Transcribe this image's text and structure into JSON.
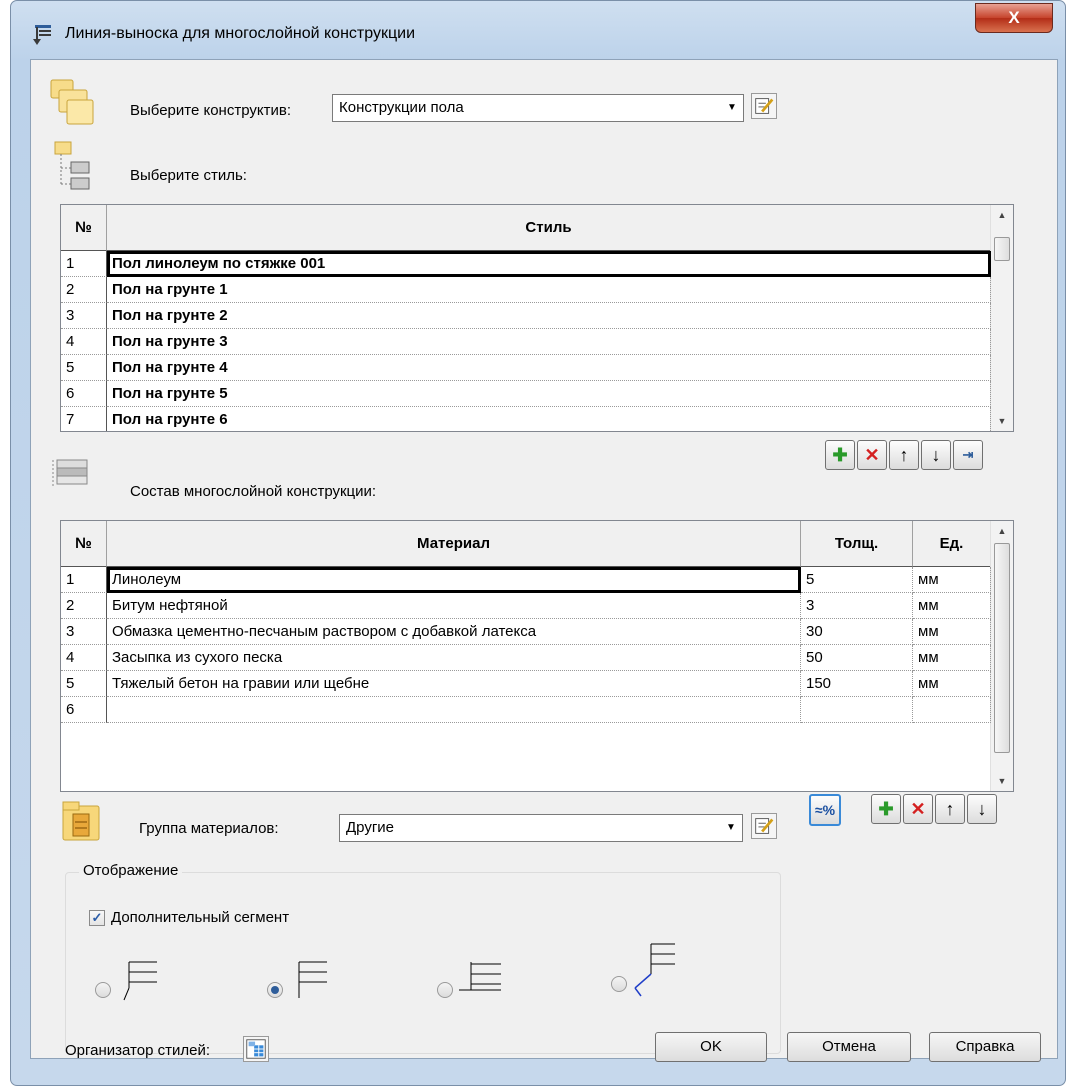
{
  "window": {
    "title": "Линия-выноска для многослойной конструкции",
    "close_label": "X"
  },
  "construct": {
    "label": "Выберите конструктив:",
    "value": "Конструкции пола"
  },
  "style_section": {
    "label": "Выберите стиль:"
  },
  "styles_table": {
    "col_num": "№",
    "col_style": "Стиль",
    "rows": [
      {
        "n": "1",
        "style": "Пол линолеум по стяжке 001"
      },
      {
        "n": "2",
        "style": "Пол на грунте 1"
      },
      {
        "n": "3",
        "style": "Пол на грунте 2"
      },
      {
        "n": "4",
        "style": "Пол на грунте 3"
      },
      {
        "n": "5",
        "style": "Пол на грунте 4"
      },
      {
        "n": "6",
        "style": "Пол на грунте 5"
      },
      {
        "n": "7",
        "style": "Пол на грунте 6"
      }
    ]
  },
  "layers_section": {
    "label": "Состав многослойной конструкции:"
  },
  "layers_table": {
    "col_num": "№",
    "col_material": "Материал",
    "col_thickness": "Толщ.",
    "col_unit": "Ед.",
    "rows": [
      {
        "n": "1",
        "material": "Линолеум",
        "thickness": "5",
        "unit": "мм"
      },
      {
        "n": "2",
        "material": "Битум нефтяной",
        "thickness": "3",
        "unit": "мм"
      },
      {
        "n": "3",
        "material": "Обмазка цементно-песчаным раствором с добавкой латекса",
        "thickness": "30",
        "unit": "мм"
      },
      {
        "n": "4",
        "material": "Засыпка из сухого песка",
        "thickness": "50",
        "unit": "мм"
      },
      {
        "n": "5",
        "material": "Тяжелый бетон на гравии или щебне",
        "thickness": "150",
        "unit": "мм"
      },
      {
        "n": "6",
        "material": "",
        "thickness": "",
        "unit": ""
      }
    ]
  },
  "material_group": {
    "label": "Группа материалов:",
    "value": "Другие"
  },
  "display": {
    "title": "Отображение",
    "extra_segment_label": "Дополнительный сегмент",
    "extra_segment_checked": true,
    "selected_variant": 2
  },
  "organizer": {
    "label": "Организатор стилей:"
  },
  "buttons": {
    "ok": "OK",
    "cancel": "Отмена",
    "help": "Справка"
  },
  "colors": {
    "add": "#2a9a2a",
    "delete": "#d42020",
    "accent": "#2e5d9a"
  },
  "icons": [
    "folders-icon",
    "style-tree-icon",
    "edit-icon",
    "add-icon",
    "delete-icon",
    "move-up-icon",
    "move-down-icon",
    "export-icon",
    "layers-icon",
    "material-filter-icon",
    "cabinet-icon",
    "style-organizer-icon"
  ]
}
